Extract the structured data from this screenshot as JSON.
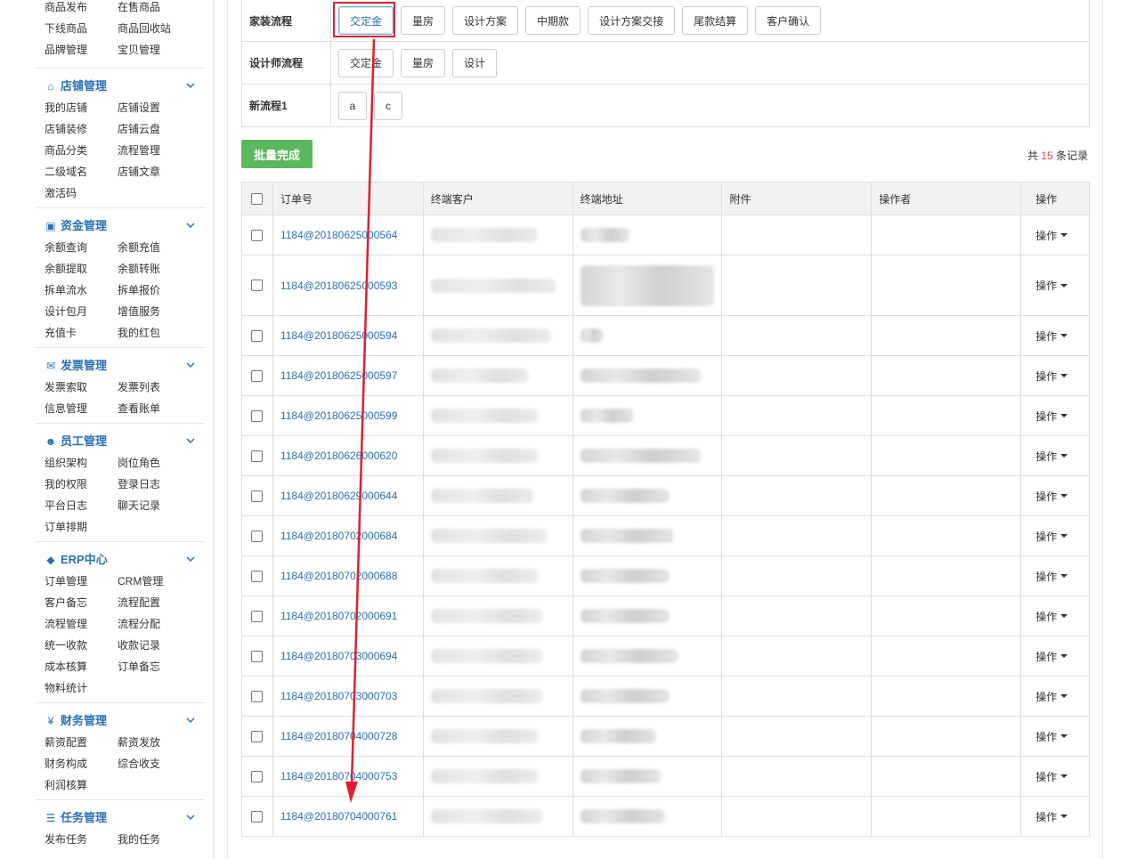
{
  "sidebar": {
    "top_items": [
      "商品发布",
      "在售商品",
      "下线商品",
      "商品回收站",
      "品牌管理",
      "宝贝管理"
    ],
    "sections": [
      {
        "title": "店铺管理",
        "icon": "home-icon",
        "items": [
          "我的店铺",
          "店铺设置",
          "店铺装修",
          "店铺云盘",
          "商品分类",
          "流程管理",
          "二级域名",
          "店铺文章",
          "激活码"
        ]
      },
      {
        "title": "资金管理",
        "icon": "money-icon",
        "items": [
          "余额查询",
          "余额充值",
          "余额提取",
          "余额转账",
          "拆单流水",
          "拆单报价",
          "设计包月",
          "增值服务",
          "充值卡",
          "我的红包"
        ]
      },
      {
        "title": "发票管理",
        "icon": "envelope-icon",
        "items": [
          "发票索取",
          "发票列表",
          "信息管理",
          "查看账单"
        ]
      },
      {
        "title": "员工管理",
        "icon": "users-icon",
        "items": [
          "组织架构",
          "岗位角色",
          "我的权限",
          "登录日志",
          "平台日志",
          "聊天记录",
          "订单排期"
        ]
      },
      {
        "title": "ERP中心",
        "icon": "drop-icon",
        "items": [
          "订单管理",
          "CRM管理",
          "客户备忘",
          "流程配置",
          "流程管理",
          "流程分配",
          "统一收款",
          "收款记录",
          "成本核算",
          "订单备忘",
          "物料统计"
        ]
      },
      {
        "title": "财务管理",
        "icon": "yen-icon",
        "items": [
          "薪资配置",
          "薪资发放",
          "财务构成",
          "综合收支",
          "利润核算"
        ]
      },
      {
        "title": "任务管理",
        "icon": "tasks-icon",
        "items": [
          "发布任务",
          "我的任务"
        ]
      }
    ]
  },
  "flows": [
    {
      "label": "家装流程",
      "buttons": [
        "交定金",
        "量房",
        "设计方案",
        "中期款",
        "设计方案交接",
        "尾款结算",
        "客户确认"
      ]
    },
    {
      "label": "设计师流程",
      "buttons": [
        "交定金",
        "量房",
        "设计"
      ]
    },
    {
      "label": "新流程1",
      "buttons": [
        "a",
        "c"
      ]
    }
  ],
  "batch_button": "批量完成",
  "total": {
    "prefix": "共",
    "count": "15",
    "suffix": "条记录"
  },
  "table": {
    "headers": [
      "订单号",
      "终端客户",
      "终端地址",
      "附件",
      "操作者",
      "操作"
    ],
    "action_label": "操作",
    "orders": [
      "1184@20180625000564",
      "1184@20180625000593",
      "1184@20180625000594",
      "1184@20180625000597",
      "1184@20180625000599",
      "1184@20180626000620",
      "1184@20180629000644",
      "1184@20180702000684",
      "1184@20180702000688",
      "1184@20180702000691",
      "1184@20180703000694",
      "1184@20180703000703",
      "1184@20180704000728",
      "1184@20180704000753",
      "1184@20180704000761"
    ]
  },
  "colors": {
    "accent": "#2a6fb6",
    "highlight": "#e21e2e",
    "success": "#5cb85c"
  }
}
